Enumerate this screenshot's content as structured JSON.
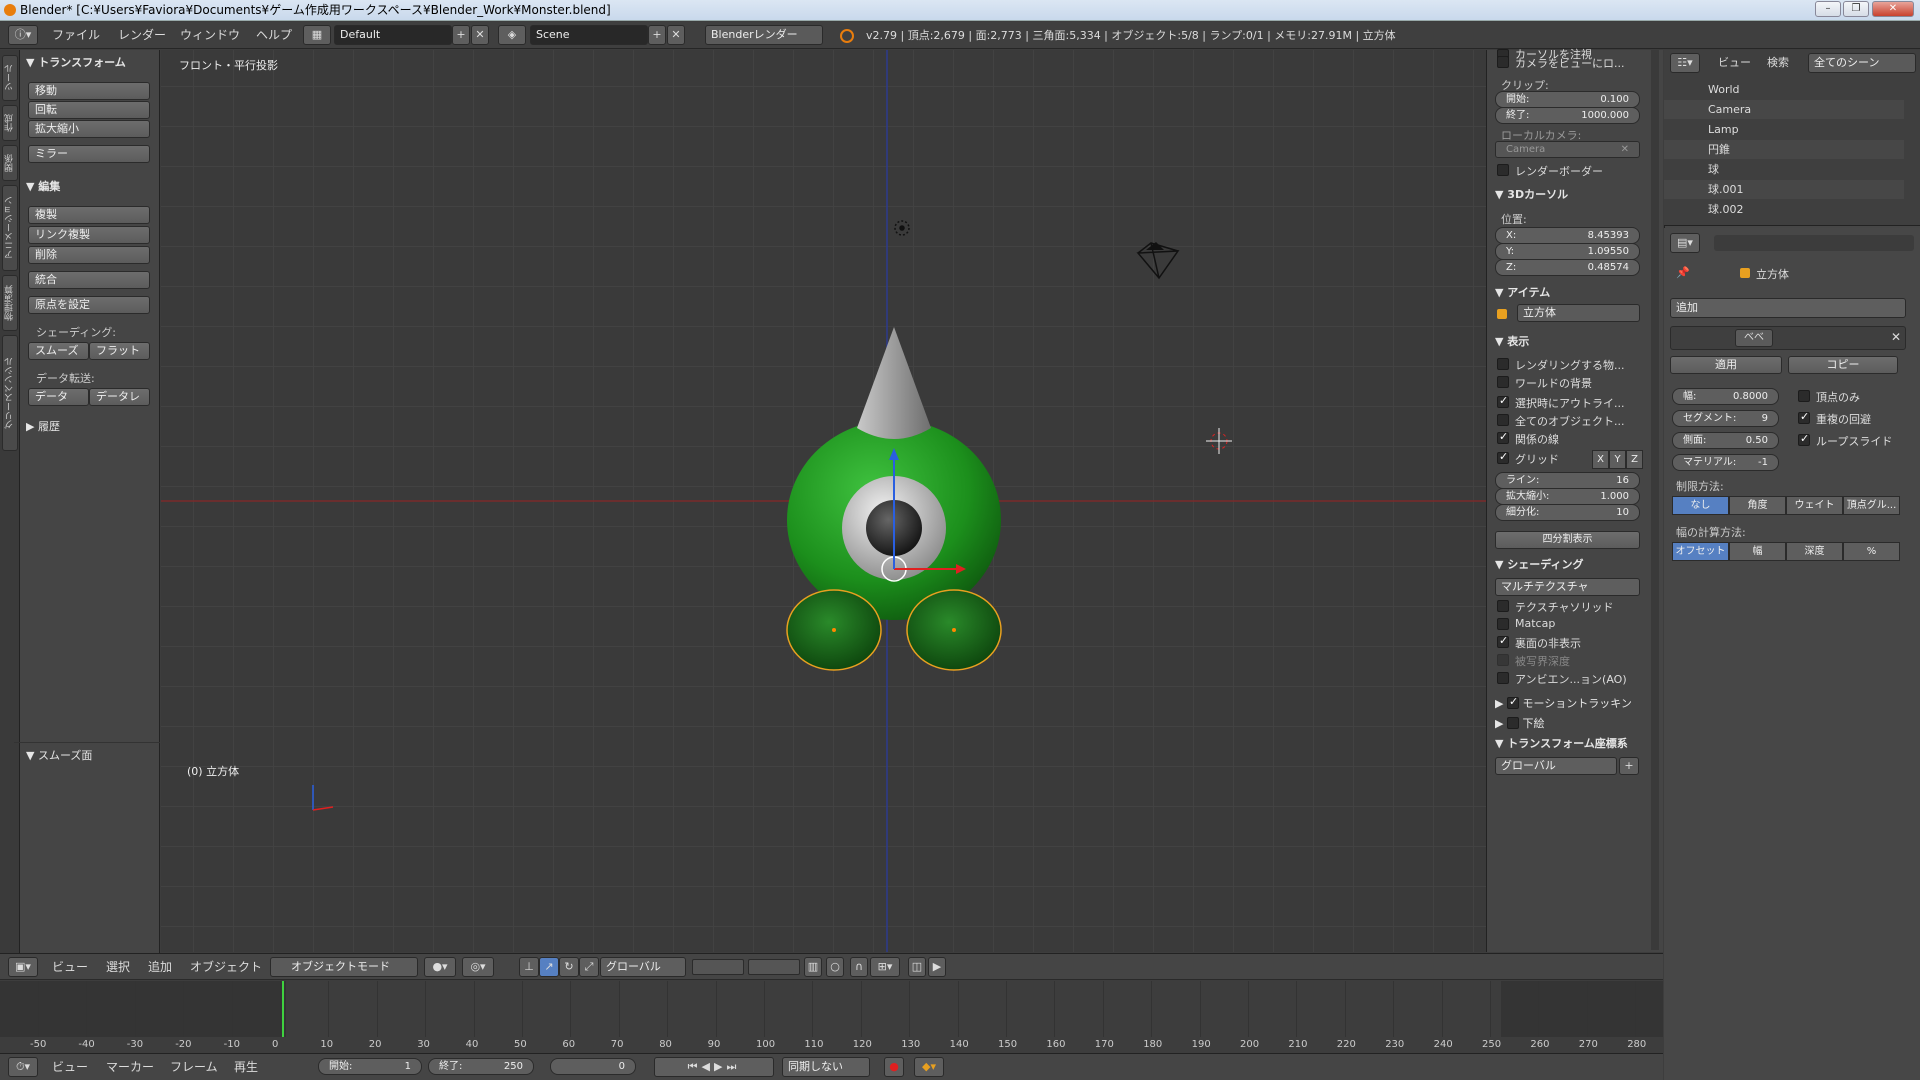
{
  "title": "Blender* [C:¥Users¥Faviora¥Documents¥ゲーム作成用ワークスペース¥Blender_Work¥Monster.blend]",
  "infobar": {
    "menus": [
      "ファイル",
      "レンダー",
      "ウィンドウ",
      "ヘルプ"
    ],
    "layout": "Default",
    "scene": "Scene",
    "engine": "Blenderレンダー",
    "stats": "v2.79 | 頂点:2,679 | 面:2,773 | 三角面:5,334 | オブジェクト:5/8 | ランプ:0/1 | メモリ:27.91M | 立方体"
  },
  "lefttabs": [
    "ツール",
    "作成",
    "関係",
    "アニメーション",
    "物理演算",
    "グリースペンシル"
  ],
  "toolshelf": {
    "transform_header": "▼ トランスフォーム",
    "transform": [
      "移動",
      "回転",
      "拡大縮小",
      "ミラー"
    ],
    "edit_header": "▼ 編集",
    "edit": [
      "複製",
      "リンク複製",
      "削除",
      "統合",
      "原点を設定"
    ],
    "shading_label": "シェーディング:",
    "smooth": "スムーズ",
    "flat": "フラット",
    "data_transfer_label": "データ転送:",
    "data": "データ",
    "data_l": "データレ",
    "history": "▶ 履歴",
    "smooth_panel": "▼ スムーズ面"
  },
  "viewport": {
    "view_label": "フロント・平行投影",
    "object_label": "(0) 立方体"
  },
  "npanel": {
    "cursor_to_sel": "カーソルを注視",
    "lock_camera": "カメラをビューにロ...",
    "clip": "クリップ:",
    "clip_start_label": "開始:",
    "clip_start": "0.100",
    "clip_end_label": "終了:",
    "clip_end": "1000.000",
    "local_camera": "ローカルカメラ:",
    "camera": "Camera",
    "render_border": "レンダーボーダー",
    "cursor_header": "3Dカーソル",
    "location": "位置:",
    "x_label": "X:",
    "x": "8.45393",
    "y_label": "Y:",
    "y": "1.09550",
    "z_label": "Z:",
    "z": "0.48574",
    "item_header": "アイテム",
    "item_name": "立方体",
    "display_header": "表示",
    "render_only": "レンダリングする物...",
    "world_bg": "ワールドの背景",
    "outline_sel": "選択時にアウトライ...",
    "all_origins": "全てのオブジェクト...",
    "rel_lines": "関係の線",
    "grid": "グリッド",
    "gx": "X",
    "gy": "Y",
    "gz": "Z",
    "lines_label": "ライン:",
    "lines": "16",
    "scale_label": "拡大縮小:",
    "scale": "1.000",
    "subdiv_label": "細分化:",
    "subdiv": "10",
    "quad": "四分割表示",
    "shading_header": "シェーディング",
    "multitex": "マルチテクスチャ",
    "tex_solid": "テクスチャソリッド",
    "matcap": "Matcap",
    "backface": "裏面の非表示",
    "dof": "被写界深度",
    "ao": "アンビエン...ョン(AO)",
    "motion": "モーショントラッキン",
    "bg": "下絵",
    "transform_orient": "トランスフォーム座標系",
    "global": "グローバル"
  },
  "outliner": {
    "view": "ビュー",
    "search": "検索",
    "all_scenes": "全てのシーン",
    "items": [
      "World",
      "Camera",
      "Lamp",
      "円錐",
      "球",
      "球.001",
      "球.002"
    ]
  },
  "properties": {
    "object": "立方体",
    "add": "追加",
    "mod_name": "べべ",
    "apply": "適用",
    "copy": "コピー",
    "width_label": "幅:",
    "width": "0.8000",
    "segments_label": "セグメント:",
    "segments": "9",
    "profile_label": "側面:",
    "profile": "0.50",
    "material_label": "マテリアル:",
    "material": "-1",
    "vertex_only": "頂点のみ",
    "clamp": "重複の回避",
    "loop_slide": "ループスライド",
    "limit_label": "制限方法:",
    "limit": [
      "なし",
      "角度",
      "ウェイト",
      "頂点グル..."
    ],
    "width_method_label": "幅の計算方法:",
    "width_method": [
      "オフセット",
      "幅",
      "深度",
      "%"
    ]
  },
  "view3d_header": {
    "menus": [
      "ビュー",
      "選択",
      "追加",
      "オブジェクト"
    ],
    "mode": "オブジェクトモード",
    "orientation": "グローバル"
  },
  "timeline": {
    "ticks": [
      "-50",
      "-40",
      "-30",
      "-20",
      "-10",
      "0",
      "10",
      "20",
      "30",
      "40",
      "50",
      "60",
      "70",
      "80",
      "90",
      "100",
      "110",
      "120",
      "130",
      "140",
      "150",
      "160",
      "170",
      "180",
      "190",
      "200",
      "210",
      "220",
      "230",
      "240",
      "250",
      "260",
      "270",
      "280"
    ],
    "menus": [
      "ビュー",
      "マーカー",
      "フレーム",
      "再生"
    ],
    "start_label": "開始:",
    "start": "1",
    "end_label": "終了:",
    "end": "250",
    "current": "0",
    "sync": "同期しない"
  },
  "colors": {
    "accent": "#5680c2",
    "green": "#1f9a1f",
    "orange": "#e87d0d"
  }
}
